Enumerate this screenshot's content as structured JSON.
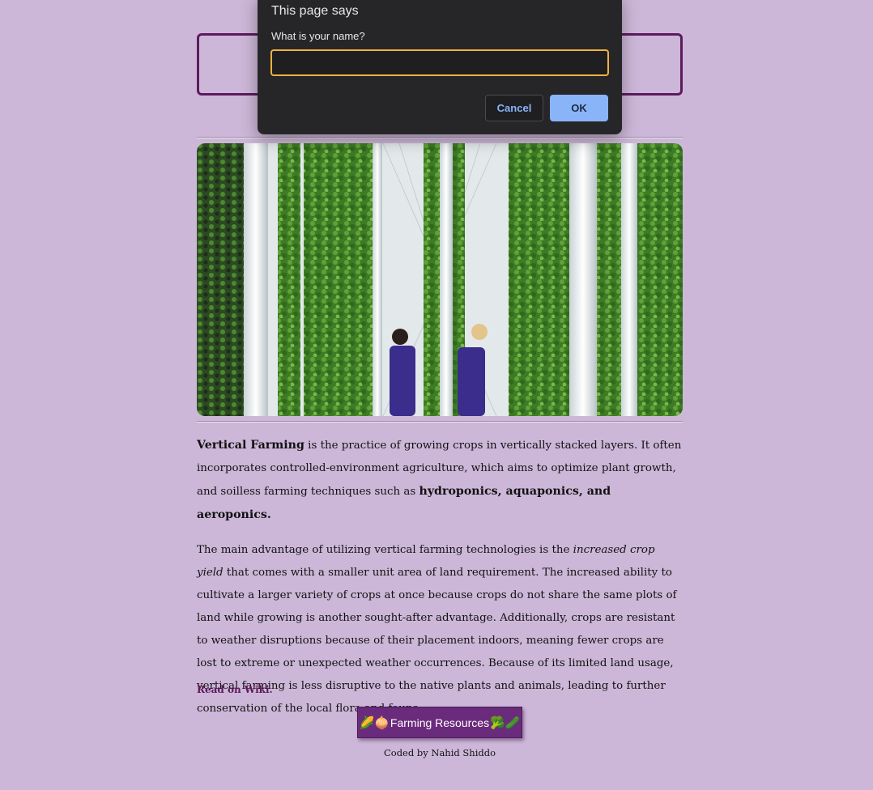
{
  "dialog": {
    "title": "This page says",
    "message": "What is your name?",
    "input_value": "",
    "cancel_label": "Cancel",
    "ok_label": "OK"
  },
  "article": {
    "p1_bold_start": "Vertical Farming",
    "p1_text": " is the practice of growing crops in vertically stacked layers. It often incorporates controlled-environment agriculture, which aims to optimize plant growth, and soilless farming techniques such as ",
    "p1_bold_end": "hydroponics, aquaponics, and aeroponics.",
    "p2_text_a": "The main advantage of utilizing vertical farming technologies is the ",
    "p2_italic": "increased crop yield",
    "p2_text_b": " that comes with a smaller unit area of land requirement. The increased ability to cultivate a larger variety of crops at once because crops do not share the same plots of land while growing is another sought-after advantage. Additionally, crops are resistant to weather disruptions because of their placement indoors, meaning fewer crops are lost to extreme or unexpected weather occurrences. Because of its limited land usage, vertical farming is less disruptive to the native plants and animals, leading to further conservation of the local flora and fauna.",
    "wiki_link": "Read on Wiki."
  },
  "resources_button": {
    "icons_left": "🌽🧅",
    "label": "Farming Resources",
    "icons_right": "🥦🥒"
  },
  "footer": "Coded by Nahid Shiddo",
  "colors": {
    "background": "#cdb7d8",
    "accent": "#5e1a5e",
    "dialog_bg": "#262629",
    "dialog_focus": "#f0b23c",
    "ok_button": "#8ab4f8"
  }
}
